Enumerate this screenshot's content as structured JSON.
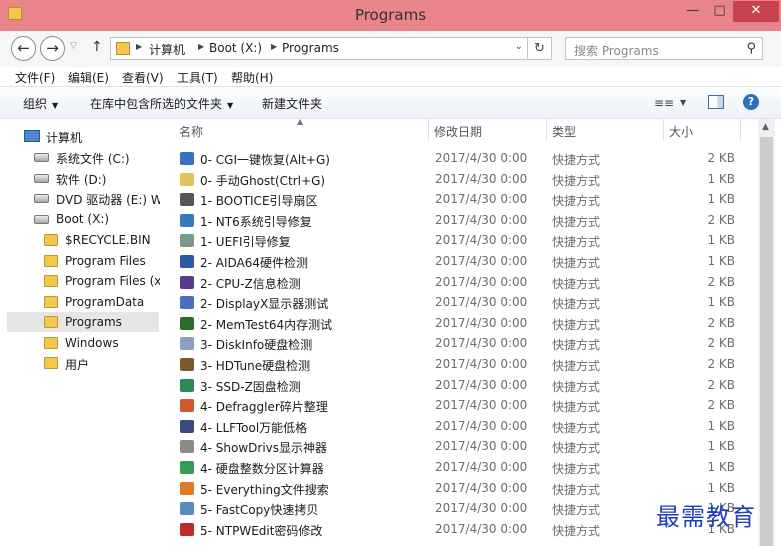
{
  "window": {
    "title": "Programs",
    "minimize_glyph": "—",
    "maximize_glyph": "□",
    "close_glyph": "✕"
  },
  "address": {
    "crumbs": [
      "计算机",
      "Boot (X:)",
      "Programs"
    ]
  },
  "search": {
    "placeholder": "搜索 Programs"
  },
  "menu": [
    "文件(F)",
    "编辑(E)",
    "查看(V)",
    "工具(T)",
    "帮助(H)"
  ],
  "commands": {
    "organize": "组织",
    "include_in_library": "在库中包含所选的文件夹",
    "new_folder": "新建文件夹"
  },
  "nav": {
    "items": [
      {
        "label": "计算机",
        "icon": "computer-icon"
      },
      {
        "label": "系统文件 (C:)",
        "icon": "drive-icon"
      },
      {
        "label": "软件 (D:)",
        "icon": "drive-icon"
      },
      {
        "label": "DVD 驱动器 (E:) Wi",
        "icon": "dvd-icon"
      },
      {
        "label": "Boot (X:)",
        "icon": "drive-icon"
      },
      {
        "label": "$RECYCLE.BIN",
        "icon": "folder-icon"
      },
      {
        "label": "Program Files",
        "icon": "folder-icon"
      },
      {
        "label": "Program Files (x",
        "icon": "folder-icon"
      },
      {
        "label": "ProgramData",
        "icon": "folder-icon"
      },
      {
        "label": "Programs",
        "icon": "folder-icon"
      },
      {
        "label": "Windows",
        "icon": "folder-icon"
      },
      {
        "label": "用户",
        "icon": "folder-icon"
      }
    ]
  },
  "columns": {
    "name": "名称",
    "modified": "修改日期",
    "type": "类型",
    "size": "大小"
  },
  "files": [
    {
      "name": "0- CGI一键恢复(Alt+G)",
      "date": "2017/4/30 0:00",
      "type": "快捷方式",
      "size": "2 KB",
      "icon": "cgi-icon",
      "color": "#3a6fc4"
    },
    {
      "name": "0- 手动Ghost(Ctrl+G)",
      "date": "2017/4/30 0:00",
      "type": "快捷方式",
      "size": "1 KB",
      "icon": "ghost-icon",
      "color": "#e3c35a"
    },
    {
      "name": "1- BOOTICE引导扇区",
      "date": "2017/4/30 0:00",
      "type": "快捷方式",
      "size": "1 KB",
      "icon": "bootice-icon",
      "color": "#555555"
    },
    {
      "name": "1- NT6系统引导修复",
      "date": "2017/4/30 0:00",
      "type": "快捷方式",
      "size": "2 KB",
      "icon": "nt6-icon",
      "color": "#3b78c2"
    },
    {
      "name": "1- UEFI引导修复",
      "date": "2017/4/30 0:00",
      "type": "快捷方式",
      "size": "1 KB",
      "icon": "uefi-icon",
      "color": "#7a9a8a"
    },
    {
      "name": "2- AIDA64硬件检测",
      "date": "2017/4/30 0:00",
      "type": "快捷方式",
      "size": "1 KB",
      "icon": "aida64-icon",
      "color": "#2a5aa8"
    },
    {
      "name": "2- CPU-Z信息检测",
      "date": "2017/4/30 0:00",
      "type": "快捷方式",
      "size": "2 KB",
      "icon": "cpuz-icon",
      "color": "#5a3a8a"
    },
    {
      "name": "2- DisplayX显示器测试",
      "date": "2017/4/30 0:00",
      "type": "快捷方式",
      "size": "1 KB",
      "icon": "displayx-icon",
      "color": "#4a6fc0"
    },
    {
      "name": "2- MemTest64内存测试",
      "date": "2017/4/30 0:00",
      "type": "快捷方式",
      "size": "2 KB",
      "icon": "memtest-icon",
      "color": "#2e6b2e"
    },
    {
      "name": "3- DiskInfo硬盘检测",
      "date": "2017/4/30 0:00",
      "type": "快捷方式",
      "size": "2 KB",
      "icon": "diskinfo-icon",
      "color": "#8aa0c0"
    },
    {
      "name": "3- HDTune硬盘检测",
      "date": "2017/4/30 0:00",
      "type": "快捷方式",
      "size": "2 KB",
      "icon": "hdtune-icon",
      "color": "#7a5a2a"
    },
    {
      "name": "3- SSD-Z固盘检测",
      "date": "2017/4/30 0:00",
      "type": "快捷方式",
      "size": "2 KB",
      "icon": "ssdz-icon",
      "color": "#2a8a5a"
    },
    {
      "name": "4- Defraggler碎片整理",
      "date": "2017/4/30 0:00",
      "type": "快捷方式",
      "size": "2 KB",
      "icon": "defraggler-icon",
      "color": "#d05a2a"
    },
    {
      "name": "4- LLFTool万能低格",
      "date": "2017/4/30 0:00",
      "type": "快捷方式",
      "size": "1 KB",
      "icon": "llftool-icon",
      "color": "#3a4a7a"
    },
    {
      "name": "4- ShowDrivs显示神器",
      "date": "2017/4/30 0:00",
      "type": "快捷方式",
      "size": "1 KB",
      "icon": "showdrivs-icon",
      "color": "#8a8a8a"
    },
    {
      "name": "4- 硬盘整数分区计算器",
      "date": "2017/4/30 0:00",
      "type": "快捷方式",
      "size": "1 KB",
      "icon": "partition-calc-icon",
      "color": "#3a9a5a"
    },
    {
      "name": "5- Everything文件搜索",
      "date": "2017/4/30 0:00",
      "type": "快捷方式",
      "size": "1 KB",
      "icon": "everything-icon",
      "color": "#e07a20"
    },
    {
      "name": "5- FastCopy快速拷贝",
      "date": "2017/4/30 0:00",
      "type": "快捷方式",
      "size": "1 KB",
      "icon": "fastcopy-icon",
      "color": "#5a8ac0"
    },
    {
      "name": "5- NTPWEdit密码修改",
      "date": "2017/4/30 0:00",
      "type": "快捷方式",
      "size": "1 KB",
      "icon": "ntpwedit-icon",
      "color": "#c02a2a"
    }
  ],
  "watermark": "最需教育"
}
